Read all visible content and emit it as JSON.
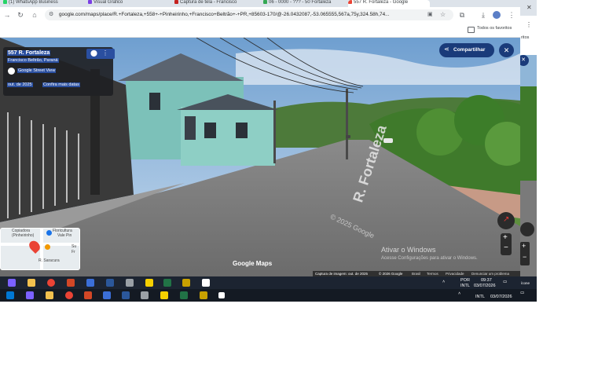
{
  "tabs": [
    {
      "label": "(1) WhatsApp Business"
    },
    {
      "label": "Visual Grafico"
    },
    {
      "label": "Captura de tela - Francisco"
    },
    {
      "label": "06 - 0000 - ??? - 50 Fortaleza"
    },
    {
      "label": "557 R. Fortaleza - Google"
    }
  ],
  "toolbar": {
    "url": "google.com/maps/place/R.+Fortaleza,+558+-+Pinheirinho,+Francisco+Beltrão+-+PR,+85603-170/@-26.0432087,-53.065555,567a,75y,324.58h,74...",
    "bookmarks_label": "Todos os favoritos",
    "right_bookmarks_label": "ritos"
  },
  "streetview": {
    "address": "557 R. Fortaleza",
    "city": "Francisco Beltrão, Paraná",
    "source": "Google Street View",
    "date": "out. de 2025",
    "more_dates": "Confira mais datas",
    "share_label": "Compartilhar",
    "street_sign": "R. Fortaleza",
    "watermark": "© 2025 Google",
    "brand": "Google Maps",
    "activation_title": "Ativar o Windows",
    "activation_sub": "Acesse Configurações para ativar o Windows.",
    "footer": {
      "capture": "Captura de imagem: out. de 2025",
      "copyright": "© 2026 Google",
      "country": "Brasil",
      "terms": "Termos",
      "privacy": "Privacidade",
      "report": "Denunciar um problema"
    },
    "minimap": {
      "label_a": "Copiadora",
      "label_b": "(Pinheirinho)",
      "label_c": "Floricultura",
      "label_d": "Vale Pin",
      "label_e": "Su",
      "label_f": "Fr",
      "label_g": "R. Saracura"
    }
  },
  "taskbar": {
    "lang": "POR",
    "layout": "INTL",
    "time": "09:37",
    "date": "03/07/2026",
    "layout2": "INTL",
    "date2": "03/07/2026",
    "right_label": "ícone"
  },
  "colors": {
    "tab_strip": "#dde3ea",
    "share_button": "#1a73e8",
    "taskbar": "#1c2431"
  }
}
